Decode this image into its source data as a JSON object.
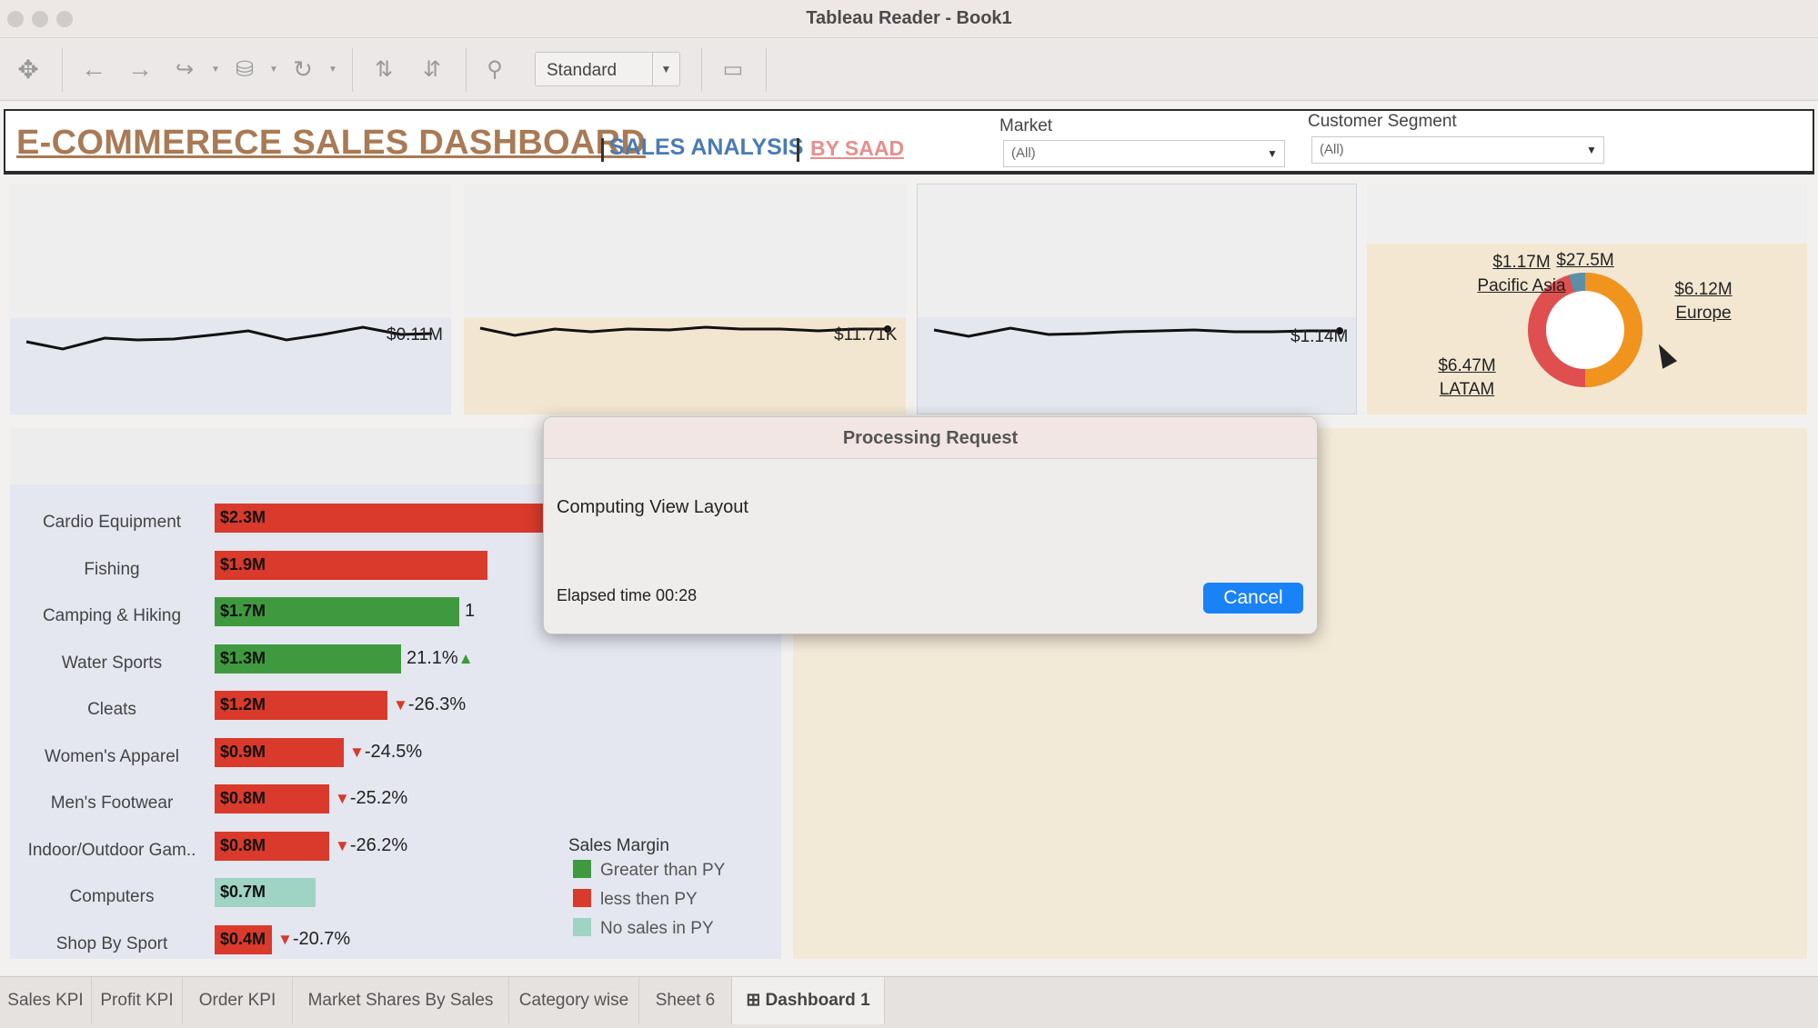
{
  "window": {
    "title": "Tableau Reader - Book1"
  },
  "toolbar": {
    "icons": [
      "move-icon",
      "back-icon",
      "forward-icon",
      "replay-icon",
      "data-source-icon",
      "refresh-icon",
      "sort-ascending-icon",
      "sort-descending-icon",
      "pin-icon",
      "presentation-icon"
    ],
    "view_select": "Standard"
  },
  "header": {
    "title": "E-COMMERECE SALES DASHBOARD",
    "subtitle": "SALES ANALYSIS",
    "author": "BY SAAD",
    "filters": [
      {
        "label": "Market",
        "value": "(All)"
      },
      {
        "label": "Customer Segment",
        "value": "(All)"
      }
    ]
  },
  "kpis": [
    {
      "value": "$0.11M",
      "band_color": "#e5e7ee"
    },
    {
      "value": "$11.71K",
      "band_color": "#f3e6d0"
    },
    {
      "value": "$1.14M",
      "band_color": "#e5e7ee"
    }
  ],
  "donut": {
    "center": "$27.5M",
    "segments": [
      {
        "name": "Pacific Asia",
        "value": "$1.17M",
        "color": "#5b8fa8"
      },
      {
        "name": "Europe",
        "value": "$6.12M",
        "color": "#f0941e"
      },
      {
        "name": "LATAM",
        "value": "$6.47M",
        "color": "#df4f4f"
      }
    ]
  },
  "categories": [
    {
      "name": "Cardio Equipment",
      "value": "$2.3M",
      "sales": 2.3,
      "status": "less",
      "pct": ""
    },
    {
      "name": "Fishing",
      "value": "$1.9M",
      "sales": 1.9,
      "status": "less",
      "pct": ""
    },
    {
      "name": "Camping & Hiking",
      "value": "$1.7M",
      "sales": 1.7,
      "status": "greater",
      "pct": "1"
    },
    {
      "name": "Water Sports",
      "value": "$1.3M",
      "sales": 1.3,
      "status": "greater",
      "pct": "21.1%"
    },
    {
      "name": "Cleats",
      "value": "$1.2M",
      "sales": 1.2,
      "status": "less",
      "pct": "-26.3%"
    },
    {
      "name": "Women's Apparel",
      "value": "$0.9M",
      "sales": 0.9,
      "status": "less",
      "pct": "-24.5%"
    },
    {
      "name": "Men's Footwear",
      "value": "$0.8M",
      "sales": 0.8,
      "status": "less",
      "pct": "-25.2%"
    },
    {
      "name": "Indoor/Outdoor Gam..",
      "value": "$0.8M",
      "sales": 0.8,
      "status": "less",
      "pct": "-26.2%"
    },
    {
      "name": "Computers",
      "value": "$0.7M",
      "sales": 0.7,
      "status": "none",
      "pct": ""
    },
    {
      "name": "Shop By Sport",
      "value": "$0.4M",
      "sales": 0.4,
      "status": "less",
      "pct": "-20.7%"
    }
  ],
  "legend": {
    "title": "Sales Margin",
    "items": [
      {
        "label": "Greater than PY",
        "color": "#3f9a3f"
      },
      {
        "label": "less then PY",
        "color": "#d93a2b"
      },
      {
        "label": "No sales in PY",
        "color": "#9fd3c3"
      }
    ]
  },
  "dialog": {
    "title": "Processing Request",
    "message": "Computing View Layout",
    "elapsed": "Elapsed time 00:28",
    "cancel": "Cancel"
  },
  "tabs": [
    "Sales KPI",
    "Profit KPI",
    "Order KPI",
    "Market Shares By Sales",
    "Category wise",
    "Sheet 6",
    "Dashboard 1"
  ],
  "active_tab": "Dashboard 1",
  "colors": {
    "greater": "#3f9a3f",
    "less": "#d93a2b",
    "none": "#9fd3c3",
    "accent": "#1a82f7"
  }
}
